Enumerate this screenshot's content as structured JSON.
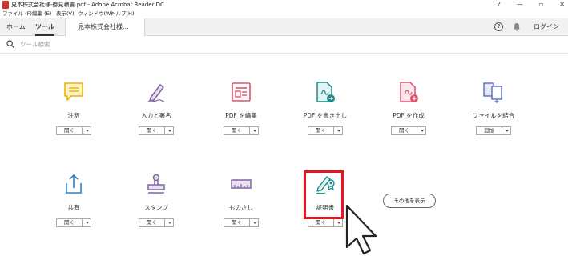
{
  "window": {
    "title": "見本株式会社様-御見積書.pdf - Adobe Acrobat Reader DC",
    "controls": [
      "?",
      "—",
      "▫",
      "✕"
    ]
  },
  "menu": [
    "ファイル (F)",
    "編集 (E)",
    "表示(V)",
    "ウィンドウ(W)",
    "ヘルプ(H)"
  ],
  "tabs": {
    "home": "ホーム",
    "tools": "ツール",
    "document": "見本株式会社様..."
  },
  "header": {
    "login": "ログイン",
    "help": "?"
  },
  "search": {
    "placeholder": "ツール検索"
  },
  "tools": [
    {
      "label": "注釈",
      "action": "開く",
      "icon": "comment-icon",
      "color": "#f5b000"
    },
    {
      "label": "入力と署名",
      "action": "開く",
      "icon": "fill-sign-icon",
      "color": "#8064a2"
    },
    {
      "label": "PDF を編集",
      "action": "開く",
      "icon": "edit-pdf-icon",
      "color": "#e0506e"
    },
    {
      "label": "PDF を書き出し",
      "action": "開く",
      "icon": "export-pdf-icon",
      "color": "#1b8b8b"
    },
    {
      "label": "PDF を作成",
      "action": "開く",
      "icon": "create-pdf-icon",
      "color": "#e0506e"
    },
    {
      "label": "ファイルを結合",
      "action": "追加",
      "icon": "combine-files-icon",
      "color": "#5b6bc0"
    },
    {
      "label": "共有",
      "action": "開く",
      "icon": "share-icon",
      "color": "#2f7fd3"
    },
    {
      "label": "スタンプ",
      "action": "開く",
      "icon": "stamp-icon",
      "color": "#8064a2"
    },
    {
      "label": "ものさし",
      "action": "開く",
      "icon": "ruler-icon",
      "color": "#8064a2"
    },
    {
      "label": "証明書",
      "action": "開く",
      "icon": "certificate-icon",
      "color": "#1b8b8b"
    }
  ],
  "more_tools": "その他を表示",
  "colors": {
    "highlight": "#e5141e",
    "accent": "#d3312b"
  }
}
